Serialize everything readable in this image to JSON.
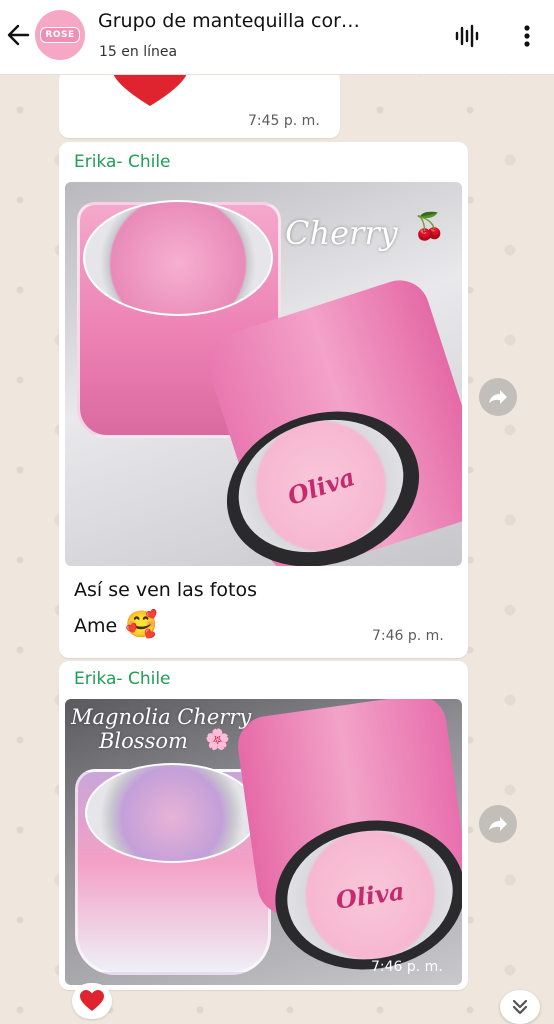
{
  "header": {
    "title": "Grupo de mantequilla cor…",
    "status": "15 en línea",
    "avatar_text": "ROSE"
  },
  "messages": [
    {
      "time": "7:45 p. m."
    },
    {
      "sender": "Erika- Chile",
      "photo_caption": "Cherry",
      "jar_brand": "Oliva",
      "text_lines": [
        "Así se ven las fotos",
        "Ame"
      ],
      "time": "7:46 p. m."
    },
    {
      "sender": "Erika- Chile",
      "photo_caption_line1": "Magnolia Cherry",
      "photo_caption_line2": "Blossom",
      "jar_brand": "Oliva",
      "time": "7:46 p. m."
    }
  ],
  "icons": {
    "back": "arrow-left-icon",
    "voice": "voice-call-icon",
    "menu": "more-vertical-icon",
    "forward": "forward-icon",
    "reaction": "heart-icon",
    "scroll": "chevron-double-down-icon"
  },
  "colors": {
    "sender": "#1f9e54",
    "accent_pink": "#f08fb3",
    "chat_bg": "#efe7de"
  }
}
